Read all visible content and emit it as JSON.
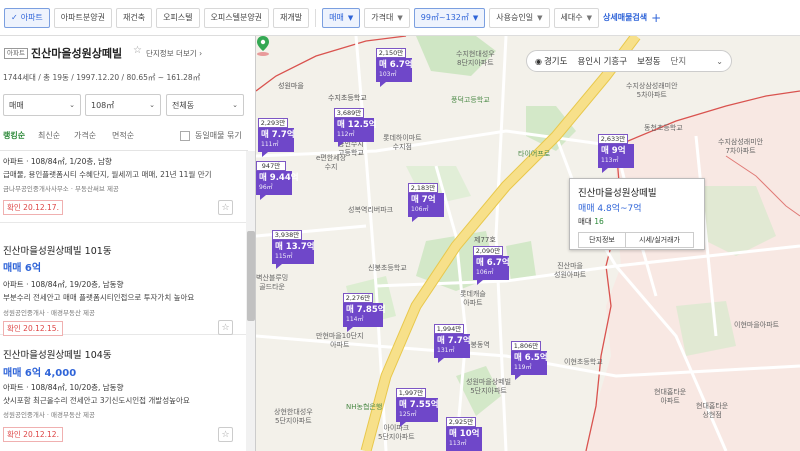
{
  "filters": {
    "chips": [
      {
        "label": "아파트",
        "active": true,
        "check": true
      },
      {
        "label": "아파트분양권"
      },
      {
        "label": "재건축"
      },
      {
        "label": "오피스텔"
      },
      {
        "label": "오피스텔분양권"
      },
      {
        "label": "재개발"
      }
    ],
    "dropdowns": [
      {
        "label": "매매",
        "active": true
      },
      {
        "label": "가격대"
      },
      {
        "label": "99㎡~132㎡",
        "active": true
      },
      {
        "label": "사용승인일"
      },
      {
        "label": "세대수"
      }
    ],
    "advanced_label": "상세매물검색",
    "plus": "+"
  },
  "complex": {
    "tag": "아파트",
    "title": "진산마을성원상떼빌",
    "more": "단지정보 더보기",
    "sub": "1744세대 / 총 19동 / 1997.12.20 / 80.65㎡ ~ 161.28㎡"
  },
  "selects": {
    "trade": "매매",
    "area": "108㎡",
    "building": "전체동"
  },
  "sort": {
    "options": [
      "랭킹순",
      "최신순",
      "가격순",
      "면적순"
    ],
    "same_label": "동일매물 묶기"
  },
  "listings": [
    {
      "l1": "아파트 · 108/84㎡, 1/20층, 남향",
      "l2": "급매물, 용인플랫폼시티 수혜단지, 월세끼고 매매, 21년 11월 만기",
      "l3": "금나무공인중개사사무소 · 부동산써브 제공",
      "confirm": "확인 20.12.17."
    },
    {
      "name": "진산마을성원상떼빌 101동",
      "price": "매매 6억",
      "l1": "아파트 · 108/84㎡, 19/20층, 남동향",
      "l2": "부분수리 전세안고 매매 플랫폼시티인접으로 투자가치 높아요",
      "l3": "성원공인중개사 · 매경부동산 제공",
      "confirm": "확인 20.12.15."
    },
    {
      "name": "진산마을성원상떼빌 104동",
      "price": "매매 6억 4,000",
      "l1": "아파트 · 108/84㎡, 10/20층, 남동향",
      "l2": "샷시포함 최근올수리 전세안고 3기신도시인접 개발성높아요",
      "l3": "성원공인중개사 · 매경부동산 제공",
      "confirm": "확인 20.12.12."
    }
  ],
  "fav_icon": "☆",
  "location": {
    "province": "경기도",
    "city": "용인시 기흥구",
    "dong": "보정동",
    "type": "단지"
  },
  "popup": {
    "title": "진산마을성원상떼빌",
    "price": "매매 4.8억~7억",
    "lease_label": "매대",
    "lease_value": "16",
    "btn_info": "단지정보",
    "btn_trade": "시세/실거래가"
  },
  "markers": [
    {
      "count": "2,150만",
      "price": "매 6.7억",
      "area": "103㎡"
    },
    {
      "count": "3,689만",
      "price": "매 12.5억",
      "area": "112㎡"
    },
    {
      "count": "2,293만",
      "price": "매 7.7억",
      "area": "111㎡"
    },
    {
      "count": "947만",
      "price": "매 9.44억",
      "area": "96㎡"
    },
    {
      "count": "2,183만",
      "price": "매 7억",
      "area": "106㎡"
    },
    {
      "count": "2,633만",
      "price": "매 9억",
      "area": "113㎡"
    },
    {
      "count": "3,938만",
      "price": "매 13.7억",
      "area": "115㎡"
    },
    {
      "count": "2,090만",
      "price": "매 6.7억",
      "area": "106㎡"
    },
    {
      "count": "2,276만",
      "price": "매 7.85억",
      "area": "114㎡"
    },
    {
      "count": "1,994만",
      "price": "매 7.7억",
      "area": "131㎡"
    },
    {
      "count": "1,806만",
      "price": "매 6.5억",
      "area": "119㎡"
    },
    {
      "count": "1,997만",
      "price": "매 7.55억",
      "area": "125㎡"
    },
    {
      "count": "2,925만",
      "price": "매 10억",
      "area": "113㎡"
    }
  ],
  "map_labels": [
    "수지초등학교",
    "수지현대성우\n8단지아파트",
    "성원마을",
    "용인수지\n고등학교",
    "풍덕고등학교",
    "동천초등학교",
    "수지상삼성래미안\n5차아파트",
    "롯데하이마트\n수지점",
    "e편한세상\n수지",
    "성복역리버파크",
    "타이어프로",
    "제77호",
    "진산마을\n성원아파트",
    "수지삼성래미안\n7차아파트",
    "벽산블루밍\n골드타운",
    "롯데캐슬\n아파트",
    "만현마을10단지\n아파트",
    "현대홈타운\n아파트",
    "이현초등학교",
    "신봉동역",
    "성원마을상떼빌\n5단지아파트",
    "NH농협은행",
    "상현한대성우\n5단지아파트",
    "아이파크\n5단지아파트",
    "이현마을아파트",
    "현대홈타운\n상현점",
    "신봉초등학교"
  ],
  "colors": {
    "accent": "#2f64d8",
    "marker": "#6f47c9",
    "green": "#2d8a3a",
    "road": "#f7e08a"
  }
}
